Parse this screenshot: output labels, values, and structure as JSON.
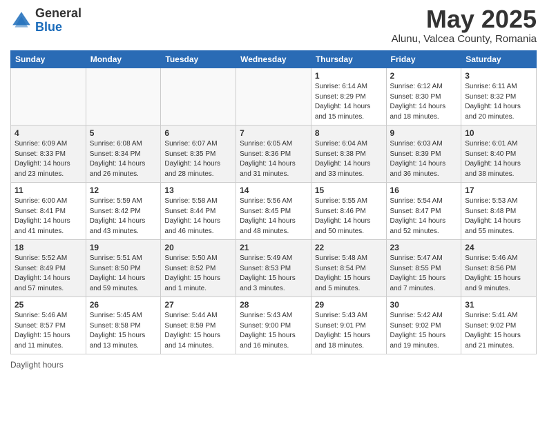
{
  "header": {
    "logo_general": "General",
    "logo_blue": "Blue",
    "month_title": "May 2025",
    "location": "Alunu, Valcea County, Romania"
  },
  "days_of_week": [
    "Sunday",
    "Monday",
    "Tuesday",
    "Wednesday",
    "Thursday",
    "Friday",
    "Saturday"
  ],
  "weeks": [
    [
      {
        "day": "",
        "info": ""
      },
      {
        "day": "",
        "info": ""
      },
      {
        "day": "",
        "info": ""
      },
      {
        "day": "",
        "info": ""
      },
      {
        "day": "1",
        "info": "Sunrise: 6:14 AM\nSunset: 8:29 PM\nDaylight: 14 hours\nand 15 minutes."
      },
      {
        "day": "2",
        "info": "Sunrise: 6:12 AM\nSunset: 8:30 PM\nDaylight: 14 hours\nand 18 minutes."
      },
      {
        "day": "3",
        "info": "Sunrise: 6:11 AM\nSunset: 8:32 PM\nDaylight: 14 hours\nand 20 minutes."
      }
    ],
    [
      {
        "day": "4",
        "info": "Sunrise: 6:09 AM\nSunset: 8:33 PM\nDaylight: 14 hours\nand 23 minutes."
      },
      {
        "day": "5",
        "info": "Sunrise: 6:08 AM\nSunset: 8:34 PM\nDaylight: 14 hours\nand 26 minutes."
      },
      {
        "day": "6",
        "info": "Sunrise: 6:07 AM\nSunset: 8:35 PM\nDaylight: 14 hours\nand 28 minutes."
      },
      {
        "day": "7",
        "info": "Sunrise: 6:05 AM\nSunset: 8:36 PM\nDaylight: 14 hours\nand 31 minutes."
      },
      {
        "day": "8",
        "info": "Sunrise: 6:04 AM\nSunset: 8:38 PM\nDaylight: 14 hours\nand 33 minutes."
      },
      {
        "day": "9",
        "info": "Sunrise: 6:03 AM\nSunset: 8:39 PM\nDaylight: 14 hours\nand 36 minutes."
      },
      {
        "day": "10",
        "info": "Sunrise: 6:01 AM\nSunset: 8:40 PM\nDaylight: 14 hours\nand 38 minutes."
      }
    ],
    [
      {
        "day": "11",
        "info": "Sunrise: 6:00 AM\nSunset: 8:41 PM\nDaylight: 14 hours\nand 41 minutes."
      },
      {
        "day": "12",
        "info": "Sunrise: 5:59 AM\nSunset: 8:42 PM\nDaylight: 14 hours\nand 43 minutes."
      },
      {
        "day": "13",
        "info": "Sunrise: 5:58 AM\nSunset: 8:44 PM\nDaylight: 14 hours\nand 46 minutes."
      },
      {
        "day": "14",
        "info": "Sunrise: 5:56 AM\nSunset: 8:45 PM\nDaylight: 14 hours\nand 48 minutes."
      },
      {
        "day": "15",
        "info": "Sunrise: 5:55 AM\nSunset: 8:46 PM\nDaylight: 14 hours\nand 50 minutes."
      },
      {
        "day": "16",
        "info": "Sunrise: 5:54 AM\nSunset: 8:47 PM\nDaylight: 14 hours\nand 52 minutes."
      },
      {
        "day": "17",
        "info": "Sunrise: 5:53 AM\nSunset: 8:48 PM\nDaylight: 14 hours\nand 55 minutes."
      }
    ],
    [
      {
        "day": "18",
        "info": "Sunrise: 5:52 AM\nSunset: 8:49 PM\nDaylight: 14 hours\nand 57 minutes."
      },
      {
        "day": "19",
        "info": "Sunrise: 5:51 AM\nSunset: 8:50 PM\nDaylight: 14 hours\nand 59 minutes."
      },
      {
        "day": "20",
        "info": "Sunrise: 5:50 AM\nSunset: 8:52 PM\nDaylight: 15 hours\nand 1 minute."
      },
      {
        "day": "21",
        "info": "Sunrise: 5:49 AM\nSunset: 8:53 PM\nDaylight: 15 hours\nand 3 minutes."
      },
      {
        "day": "22",
        "info": "Sunrise: 5:48 AM\nSunset: 8:54 PM\nDaylight: 15 hours\nand 5 minutes."
      },
      {
        "day": "23",
        "info": "Sunrise: 5:47 AM\nSunset: 8:55 PM\nDaylight: 15 hours\nand 7 minutes."
      },
      {
        "day": "24",
        "info": "Sunrise: 5:46 AM\nSunset: 8:56 PM\nDaylight: 15 hours\nand 9 minutes."
      }
    ],
    [
      {
        "day": "25",
        "info": "Sunrise: 5:46 AM\nSunset: 8:57 PM\nDaylight: 15 hours\nand 11 minutes."
      },
      {
        "day": "26",
        "info": "Sunrise: 5:45 AM\nSunset: 8:58 PM\nDaylight: 15 hours\nand 13 minutes."
      },
      {
        "day": "27",
        "info": "Sunrise: 5:44 AM\nSunset: 8:59 PM\nDaylight: 15 hours\nand 14 minutes."
      },
      {
        "day": "28",
        "info": "Sunrise: 5:43 AM\nSunset: 9:00 PM\nDaylight: 15 hours\nand 16 minutes."
      },
      {
        "day": "29",
        "info": "Sunrise: 5:43 AM\nSunset: 9:01 PM\nDaylight: 15 hours\nand 18 minutes."
      },
      {
        "day": "30",
        "info": "Sunrise: 5:42 AM\nSunset: 9:02 PM\nDaylight: 15 hours\nand 19 minutes."
      },
      {
        "day": "31",
        "info": "Sunrise: 5:41 AM\nSunset: 9:02 PM\nDaylight: 15 hours\nand 21 minutes."
      }
    ]
  ],
  "footer": {
    "note": "Daylight hours"
  }
}
